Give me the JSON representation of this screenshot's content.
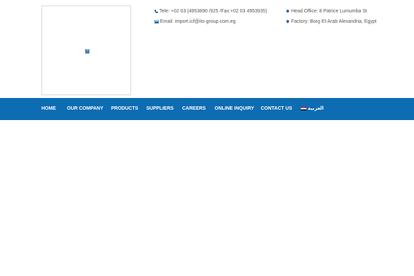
{
  "header": {
    "contact": {
      "phone": "Tele: +02 03 (4953890 /925 /Fax:+02 03 4953935)",
      "email": "Email: import.icf@ito-group.com.eg",
      "head_office": "Head Office: 8 Patrice Lumumba St",
      "factory": "Factory: Borg El-Arab Alexandria, Egypt"
    },
    "logo_placeholder": "?"
  },
  "nav": {
    "items": [
      {
        "label": "HOME"
      },
      {
        "label": "OUR COMPANY"
      },
      {
        "label": "PRODUCTS"
      },
      {
        "label": "SUPPLIERS"
      },
      {
        "label": "CAREERS"
      },
      {
        "label": "ONLINE INQUIRY"
      },
      {
        "label": "CONTACT US"
      },
      {
        "label": "العربية"
      }
    ]
  },
  "colors": {
    "nav_bg": "#0d6cb2",
    "icon_accent": "#2a6fb0"
  }
}
